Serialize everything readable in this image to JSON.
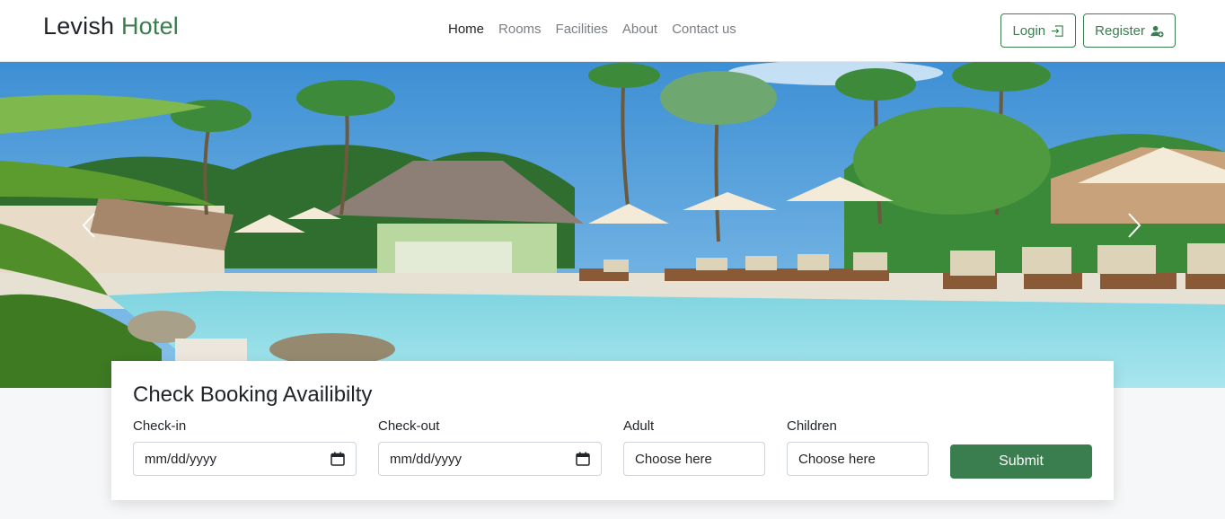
{
  "brand": {
    "part1": "Levish",
    "part2": "Hotel",
    "accent_color": "#3a7d4f"
  },
  "nav": {
    "items": [
      {
        "label": "Home",
        "active": true
      },
      {
        "label": "Rooms",
        "active": false
      },
      {
        "label": "Facilities",
        "active": false
      },
      {
        "label": "About",
        "active": false
      },
      {
        "label": "Contact us",
        "active": false
      }
    ]
  },
  "auth": {
    "login_label": "Login",
    "login_icon": "box-arrow-in-right-icon",
    "register_label": "Register",
    "register_icon": "person-plus-icon"
  },
  "hero": {
    "image": "resort-pool-with-palm-trees",
    "prev_icon": "chevron-left-icon",
    "next_icon": "chevron-right-icon"
  },
  "booking": {
    "title": "Check Booking Availibilty",
    "checkin": {
      "label": "Check-in",
      "value": "mm/dd/yyyy",
      "icon": "calendar-icon"
    },
    "checkout": {
      "label": "Check-out",
      "value": "mm/dd/yyyy",
      "icon": "calendar-icon"
    },
    "adult": {
      "label": "Adult",
      "value": "Choose here"
    },
    "children": {
      "label": "Children",
      "value": "Choose here"
    },
    "submit_label": "Submit"
  }
}
